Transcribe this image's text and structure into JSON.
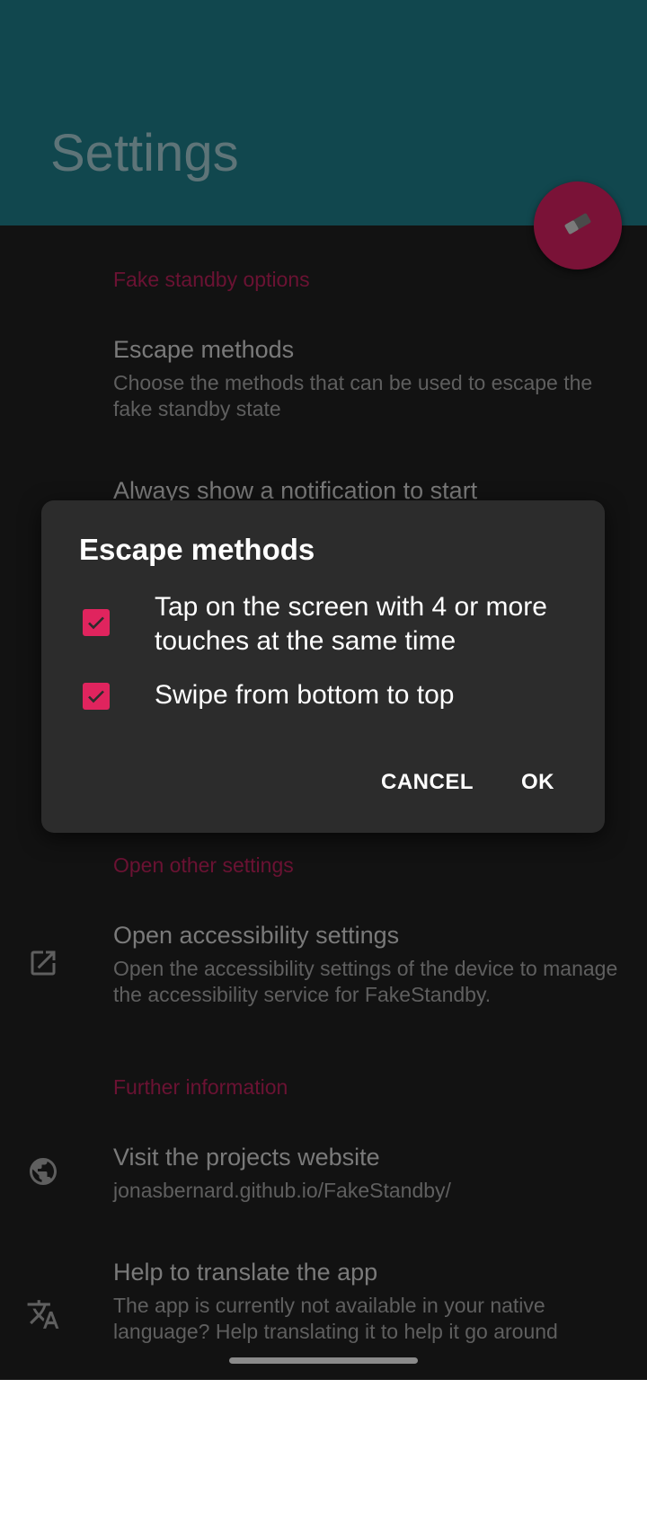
{
  "app": {
    "title": "Settings"
  },
  "fab": {
    "icon": "eraser-icon"
  },
  "sections": {
    "fake_standby": {
      "header": "Fake standby options",
      "escape_methods": {
        "title": "Escape methods",
        "summary": "Choose the methods that can be used to escape the fake standby state"
      },
      "notification": {
        "title": "Always show a notification to start"
      }
    },
    "other_settings": {
      "header": "Open other settings",
      "accessibility": {
        "icon": "open-external-icon",
        "title": "Open accessibility settings",
        "summary": "Open the accessibility settings of the device to manage the accessibility service for FakeStandby."
      }
    },
    "further_info": {
      "header": "Further information",
      "website": {
        "icon": "globe-icon",
        "title": "Visit the projects website",
        "summary": "jonasbernard.github.io/FakeStandby/"
      },
      "translate": {
        "icon": "translate-icon",
        "title": "Help to translate the app",
        "summary": "The app is currently not available in your native language? Help translating it to help it go around"
      }
    }
  },
  "dialog": {
    "title": "Escape methods",
    "options": [
      {
        "label": "Tap on the screen with 4 or more touches at the same time",
        "checked": true
      },
      {
        "label": "Swipe from bottom to top",
        "checked": true
      }
    ],
    "cancel_label": "CANCEL",
    "ok_label": "OK"
  },
  "colors": {
    "toolbar": "#11474e",
    "accent": "#e0245e",
    "background": "#121212",
    "dialog": "#2c2c2c"
  }
}
